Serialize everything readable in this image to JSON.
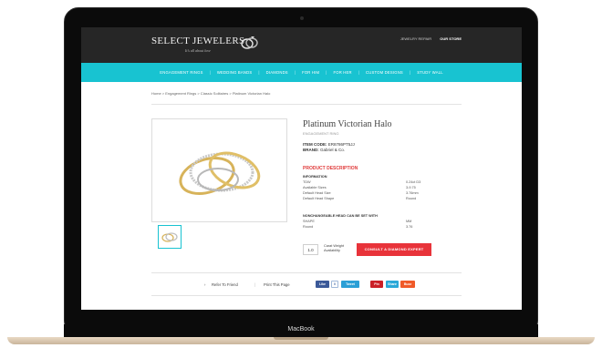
{
  "device": {
    "label": "MacBook"
  },
  "site": {
    "logo_text": "SELECT JEWELERS",
    "logo_tagline": "It's all about love",
    "top_links": [
      "JEWELRY REPAIR",
      "OUR STORE"
    ],
    "nav": [
      "ENGAGEMENT RINGS",
      "WEDDING BANDS",
      "DIAMONDS",
      "FOR HIM",
      "FOR HER",
      "CUSTOM DESIGNS",
      "STUDY WALL"
    ],
    "accent": "#18c3d1"
  },
  "breadcrumb": "Home > Engagement Rings > Classic Solitaires > Platinum Victorian Halo",
  "product": {
    "title": "Platinum Victorian Halo",
    "subtitle": "ENGAGEMENT RING",
    "item_code_label": "ITEM CODE:",
    "item_code": "ER8786PT5JJ",
    "brand_label": "BRAND:",
    "brand": "Gabriel & Co.",
    "description_heading": "PRODUCT DESCRIPTION",
    "info_heading": "INFORMATION",
    "info_rows": [
      {
        "label": "TDW",
        "value": "0.24ct D3"
      },
      {
        "label": "Available Sizes",
        "value": "3-9.75"
      },
      {
        "label": "Default Head Size",
        "value": "3.76mm"
      },
      {
        "label": "Default Head Shape",
        "value": "Round"
      }
    ],
    "head_heading": "NONCHANGEABLE HEAD CAN BE SET WITH",
    "head_rows": [
      {
        "label": "SHAPE",
        "value": "MM"
      },
      {
        "label": "Round",
        "value": "3.76"
      }
    ],
    "quantity": "1.0",
    "carat_label": "Carat Weight",
    "availability_label": "Availability",
    "cta_label": "CONSULT A DIAMOND EXPERT"
  },
  "footer": {
    "refer": "Refer To Friend",
    "print": "Print This Page",
    "social": [
      "Like",
      "Tweet",
      "Pin",
      "Share",
      "Buzz"
    ]
  }
}
